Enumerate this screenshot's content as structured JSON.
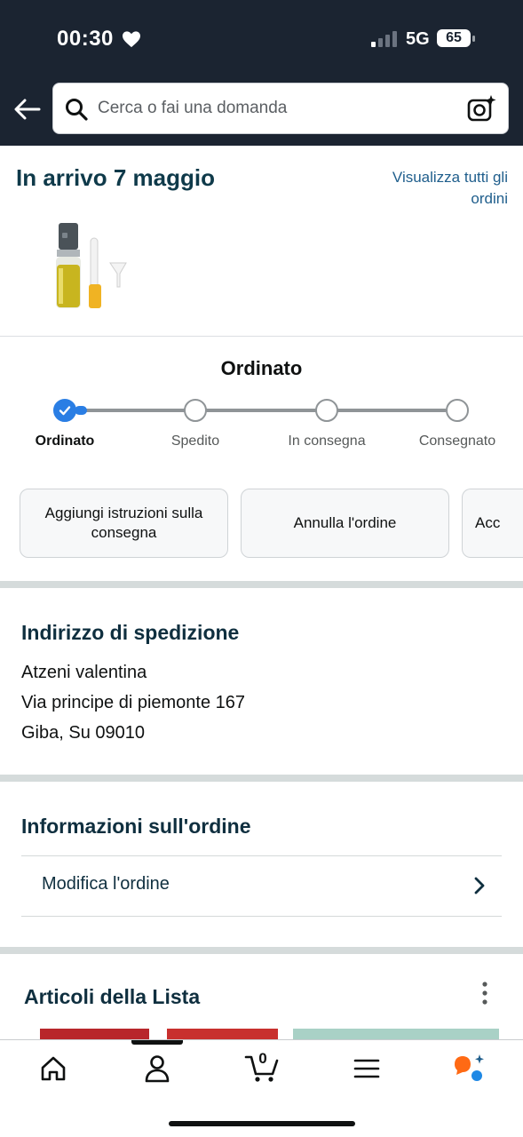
{
  "status_bar": {
    "time": "00:30",
    "network": "5G",
    "battery": "65"
  },
  "search": {
    "placeholder": "Cerca o fai una domanda"
  },
  "delivery": {
    "heading": "In arrivo 7 maggio",
    "view_all_orders": "Visualizza tutti gli ordini"
  },
  "tracking": {
    "current_status": "Ordinato",
    "steps": [
      {
        "label": "Ordinato",
        "done": true
      },
      {
        "label": "Spedito",
        "done": false
      },
      {
        "label": "In consegna",
        "done": false
      },
      {
        "label": "Consegnato",
        "done": false
      }
    ]
  },
  "actions": {
    "add_instructions": "Aggiungi istruzioni sulla consegna",
    "cancel_order": "Annulla l'ordine",
    "third": "Acc"
  },
  "shipping_address": {
    "title": "Indirizzo di spedizione",
    "name": "Atzeni valentina",
    "street": "Via principe di piemonte 167",
    "city": "Giba, Su 09010"
  },
  "order_info": {
    "title": "Informazioni sull'ordine",
    "modify_label": "Modifica l'ordine"
  },
  "list_items": {
    "title": "Articoli della Lista"
  },
  "bottom_nav": {
    "cart_count": "0"
  },
  "colors": {
    "header_bg": "#1b2431",
    "accent_blue": "#2a7ee4",
    "link": "#1f5e8c"
  }
}
